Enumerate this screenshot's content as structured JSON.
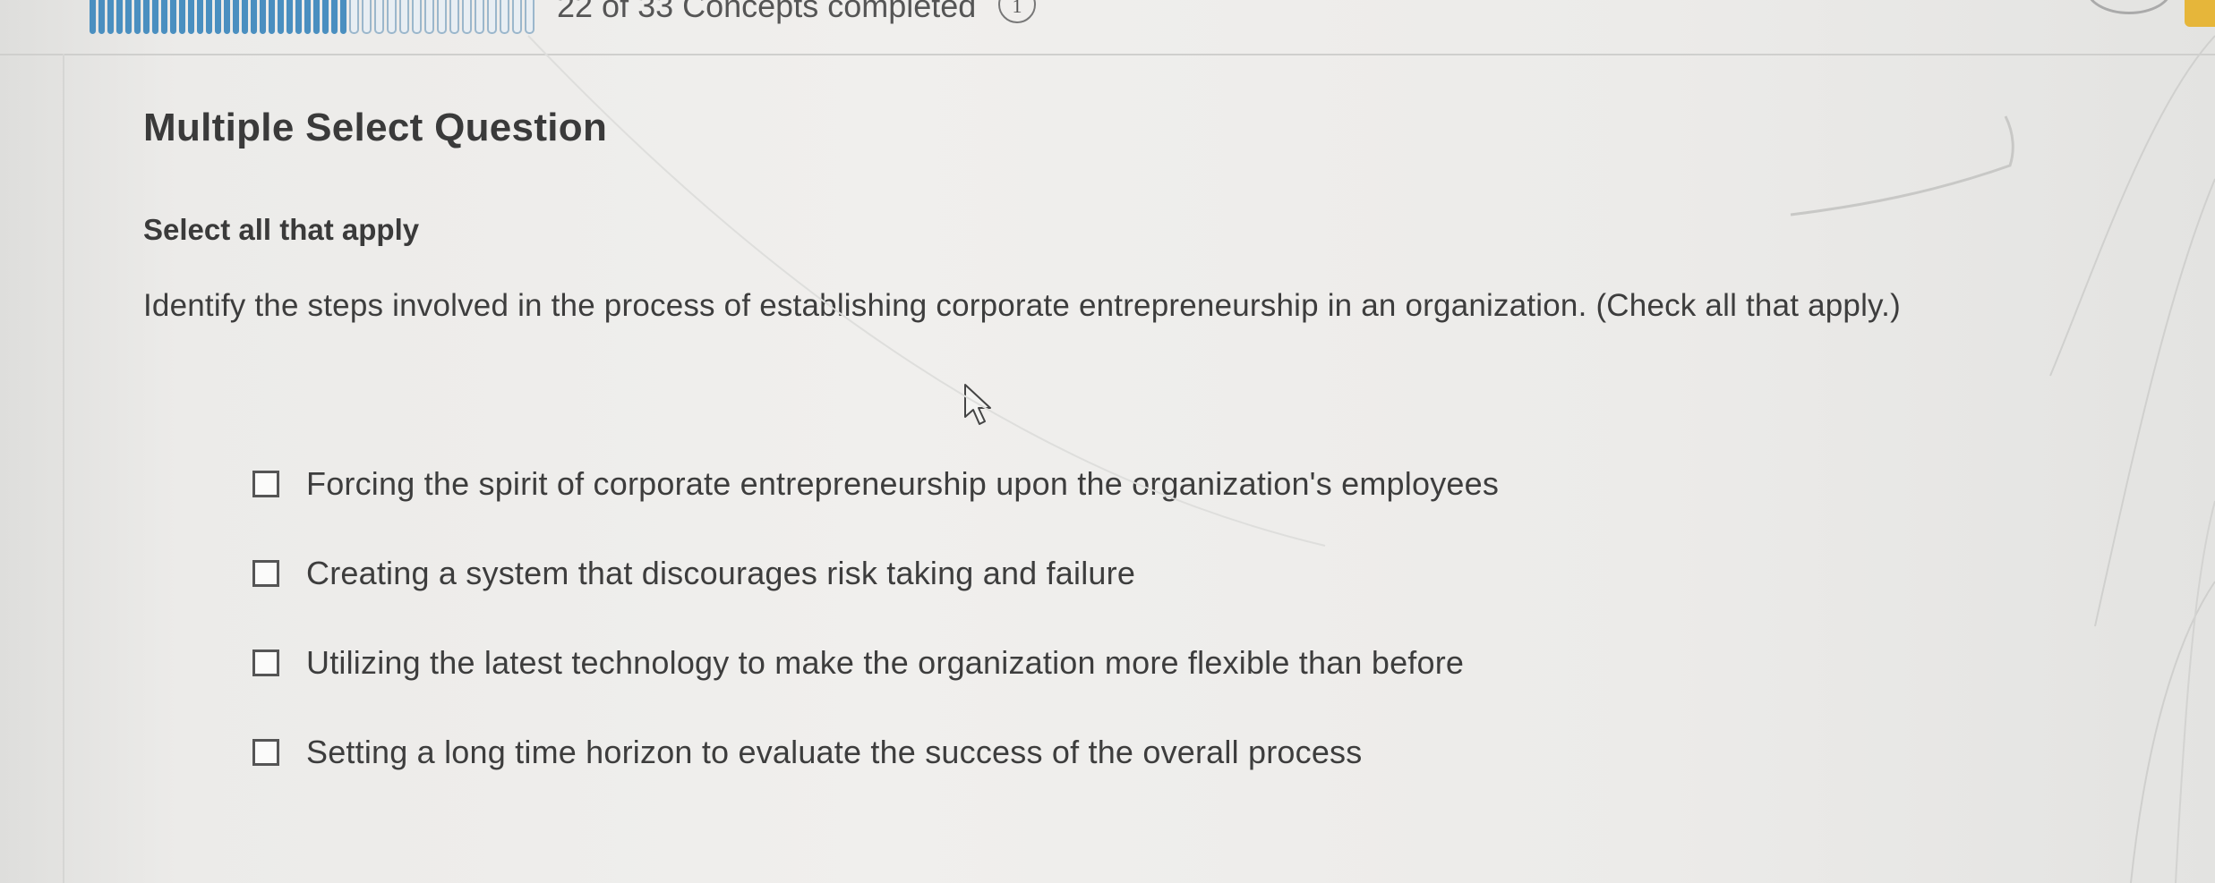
{
  "progress": {
    "completed": 22,
    "total": 33,
    "text": "22 of 33 Concepts completed",
    "info_number": "1"
  },
  "question": {
    "type_label": "Multiple Select Question",
    "instruction": "Select all that apply",
    "prompt": "Identify the steps involved in the process of establishing corporate entrepreneurship in an organization. (Check all that apply.)",
    "options": [
      {
        "label": "Forcing the spirit of corporate entrepreneurship upon the organization's employees",
        "checked": false
      },
      {
        "label": "Creating a system that discourages risk taking and failure",
        "checked": false
      },
      {
        "label": "Utilizing the latest technology to make the organization more flexible than before",
        "checked": false
      },
      {
        "label": "Setting a long time horizon to evaluate the success of the overall process",
        "checked": false
      }
    ]
  },
  "colors": {
    "progress_done": "#4a8fc0",
    "badge": "#e6b63a",
    "text": "#3d3d3d"
  }
}
